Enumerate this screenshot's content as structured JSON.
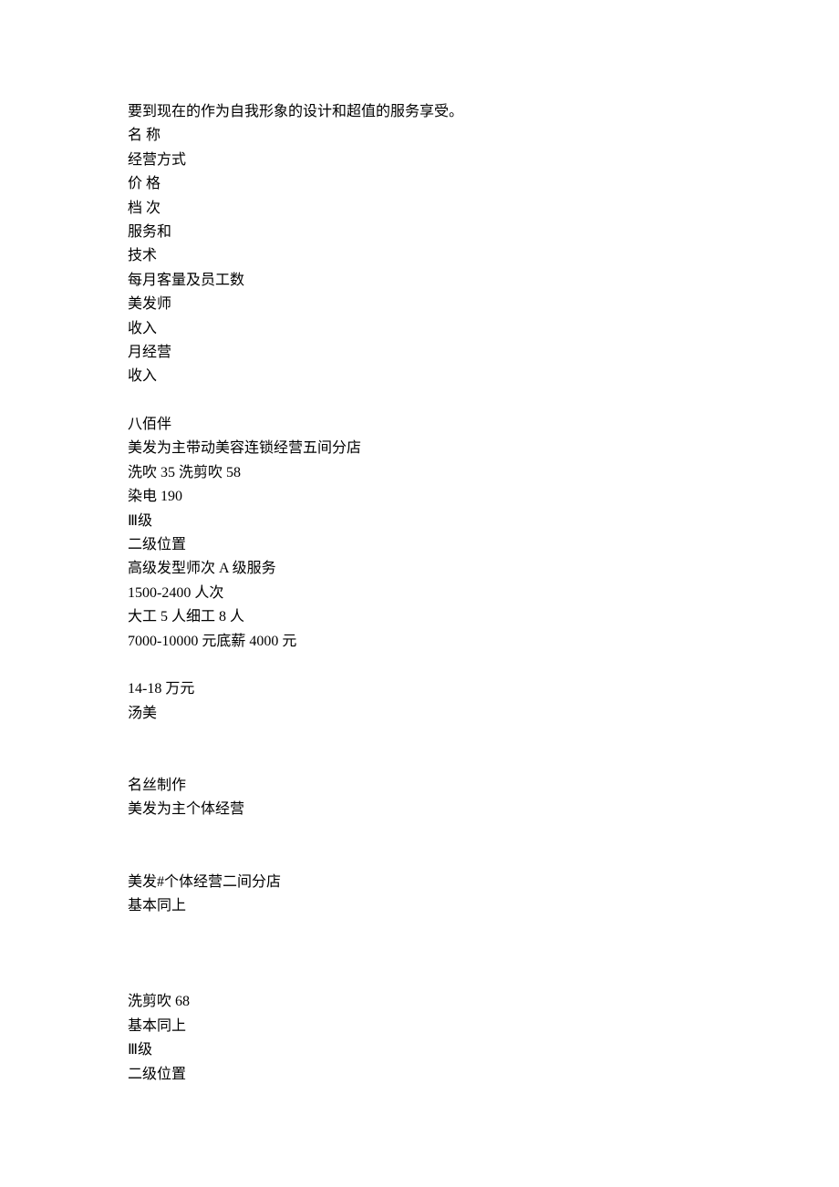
{
  "lines": [
    "要到现在的作为自我形象的设计和超值的服务享受。",
    "名 称",
    "经营方式",
    "价 格",
    "档 次",
    "服务和",
    "技术",
    "每月客量及员工数",
    "美发师",
    "收入",
    "月经营",
    "收入",
    "",
    "八佰伴",
    "美发为主带动美容连锁经营五间分店",
    "洗吹 35 洗剪吹 58",
    "染电 190",
    "Ⅲ级",
    "二级位置",
    "高级发型师次 A 级服务",
    "1500-2400 人次",
    "大工 5 人细工 8 人",
    "7000-10000 元底薪 4000 元",
    "",
    "14-18 万元",
    "汤美",
    "",
    "",
    "名丝制作",
    "美发为主个体经营",
    "",
    "",
    "美发#个体经营二间分店",
    "基本同上",
    "",
    "",
    "",
    "洗剪吹 68",
    "基本同上",
    "Ⅲ级",
    "二级位置"
  ]
}
